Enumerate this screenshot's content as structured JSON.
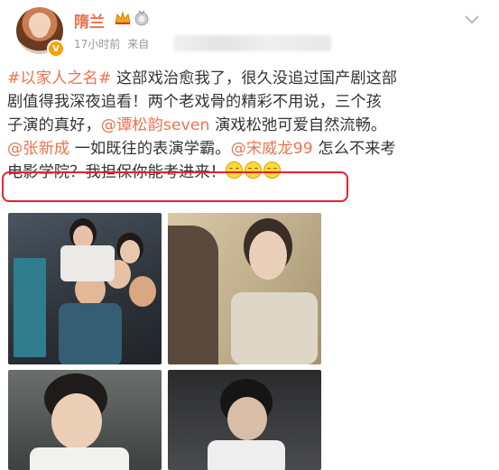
{
  "post": {
    "author": "隋兰",
    "time": "17小时前",
    "source_prefix": "来自",
    "verified_mark": "V",
    "content_lines": [
      [
        {
          "t": "#以家人之名#",
          "k": "link"
        },
        {
          "t": " 这部戏治愈我了，很久没追过国产剧这部",
          "k": "text"
        }
      ],
      [
        {
          "t": "剧值得我深夜追看！两个老戏骨的精彩不用说，三个孩",
          "k": "text"
        }
      ],
      [
        {
          "t": "子演的真好，",
          "k": "text"
        },
        {
          "t": "@谭松韵seven",
          "k": "link"
        },
        {
          "t": " 演戏松弛可爱自然流畅。",
          "k": "text"
        }
      ],
      [
        {
          "t": "@张新成",
          "k": "link"
        },
        {
          "t": " 一如既往的表演学霸。",
          "k": "text"
        },
        {
          "t": "@宋威龙99",
          "k": "link"
        },
        {
          "t": " 怎么不来考",
          "k": "text"
        }
      ],
      [
        {
          "t": "电影学院？我担保你能考进来！",
          "k": "text"
        },
        {
          "t": "emoji",
          "k": "emoji"
        },
        {
          "t": "emoji",
          "k": "emoji"
        },
        {
          "t": "emoji",
          "k": "emoji"
        }
      ]
    ]
  },
  "colors": {
    "accent": "#eb7350",
    "highlight_border": "#e8212e"
  },
  "icons": [
    "crown-badge-icon",
    "medal-badge-icon",
    "chevron-down-icon",
    "smile-emoji-icon"
  ]
}
